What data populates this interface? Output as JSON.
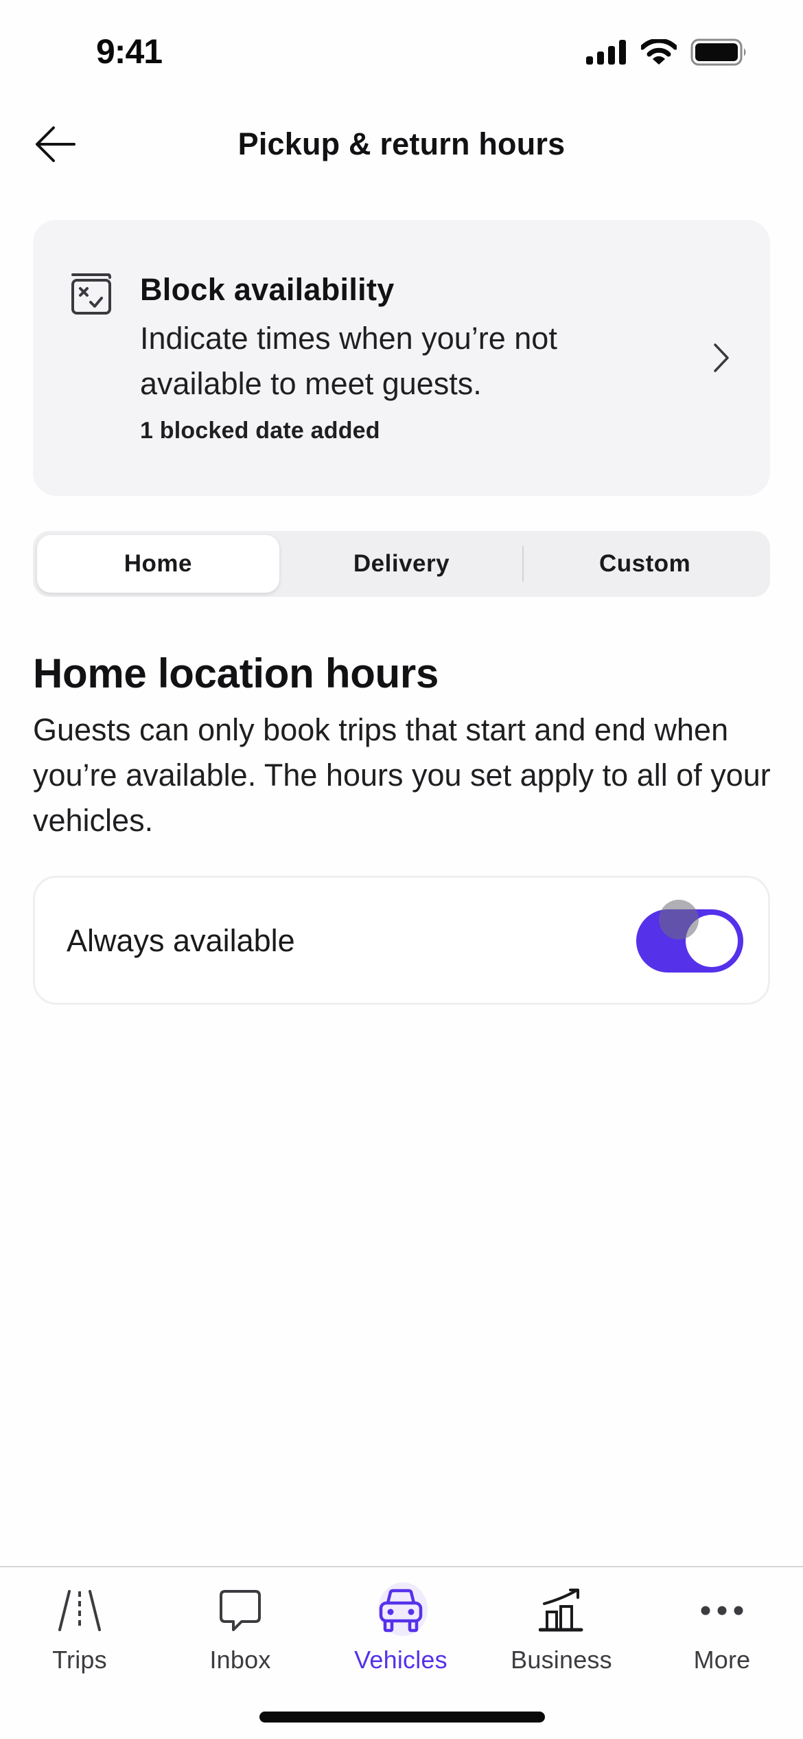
{
  "status_bar": {
    "time": "9:41",
    "icons": [
      "cellular-signal-icon",
      "wifi-icon",
      "battery-icon"
    ]
  },
  "header": {
    "back_icon": "arrow-left-icon",
    "title": "Pickup & return hours"
  },
  "block_card": {
    "icon": "calendar-block-icon",
    "title": "Block availability",
    "description": "Indicate times when you’re not available to meet guests.",
    "note": "1 blocked date added",
    "chevron_icon": "chevron-right-icon"
  },
  "tabs": {
    "items": [
      {
        "label": "Home",
        "active": true
      },
      {
        "label": "Delivery",
        "active": false
      },
      {
        "label": "Custom",
        "active": false
      }
    ]
  },
  "section": {
    "title": "Home location hours",
    "description": "Guests can only book trips that start and end when you’re available. The hours you set apply to all of your vehicles."
  },
  "always_available": {
    "label": "Always available",
    "enabled": true
  },
  "bottom_nav": {
    "items": [
      {
        "label": "Trips",
        "icon": "road-icon",
        "active": false
      },
      {
        "label": "Inbox",
        "icon": "chat-bubble-icon",
        "active": false
      },
      {
        "label": "Vehicles",
        "icon": "car-icon",
        "active": true
      },
      {
        "label": "Business",
        "icon": "chart-growth-icon",
        "active": false
      },
      {
        "label": "More",
        "icon": "more-dots-icon",
        "active": false
      }
    ]
  },
  "colors": {
    "accent": "#5531ea",
    "card_bg": "#f4f3f6",
    "text_primary": "#121214",
    "nav_inactive": "#3c3c40",
    "active_halo": "#f0ebfd"
  }
}
